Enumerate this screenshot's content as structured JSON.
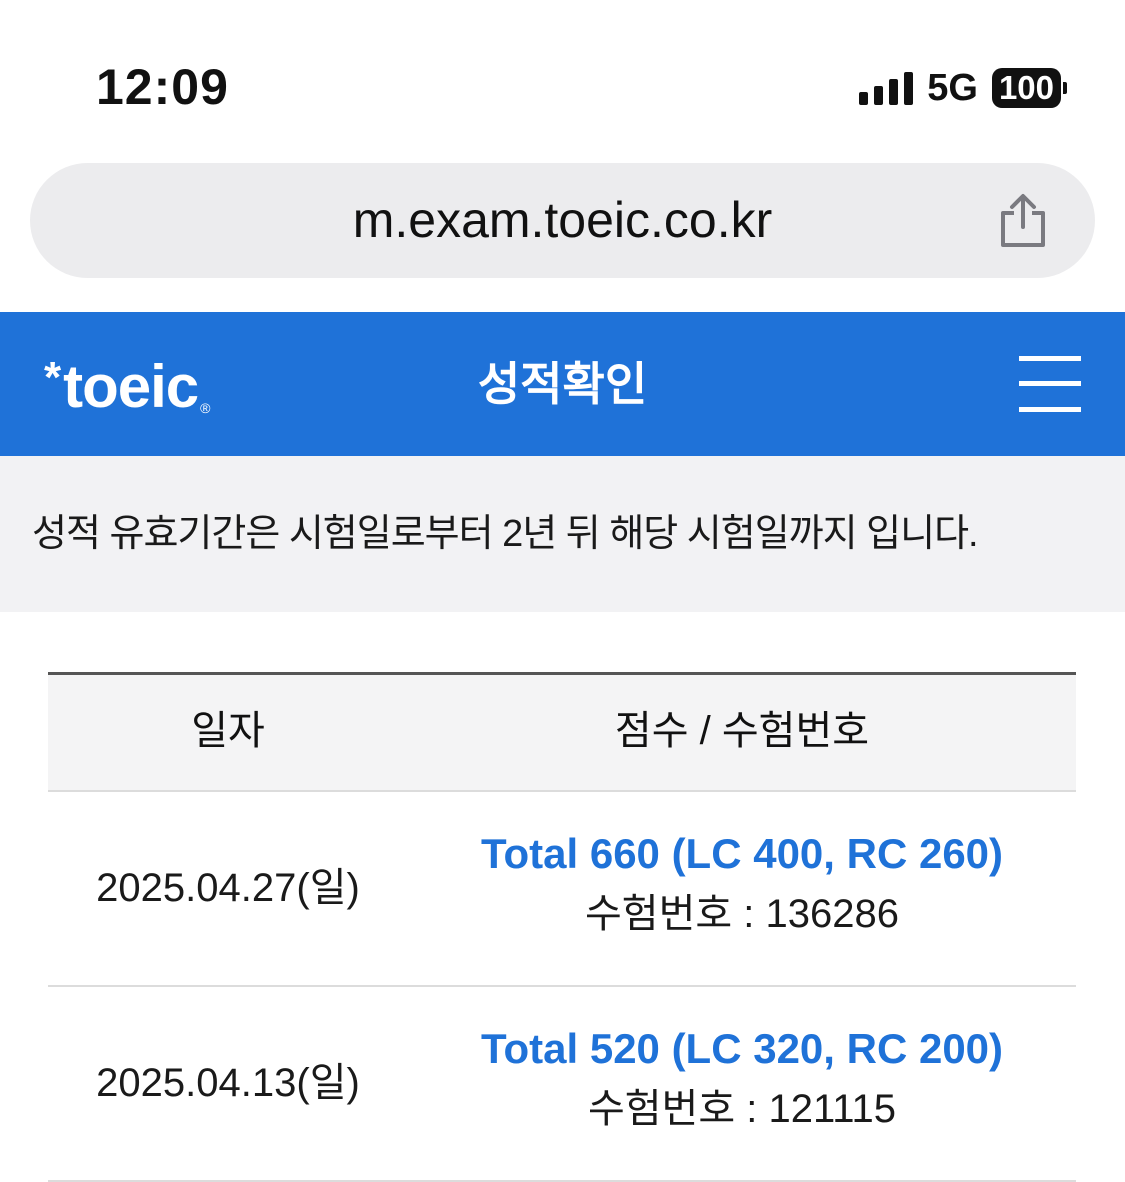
{
  "status_bar": {
    "time": "12:09",
    "network": "5G",
    "battery": "100"
  },
  "browser": {
    "url": "m.exam.toeic.co.kr",
    "share_icon": "share-icon"
  },
  "header": {
    "logo_star": "*",
    "logo_text": "toeic",
    "logo_mark": "®",
    "title": "성적확인",
    "menu_icon": "hamburger-menu-icon"
  },
  "notice": {
    "text": "성적 유효기간은 시험일로부터 2년 뒤 해당 시험일까지 입니다."
  },
  "table": {
    "headers": {
      "date": "일자",
      "score": "점수 / 수험번호"
    },
    "rows": [
      {
        "date": "2025.04.27(일)",
        "score": "Total 660 (LC 400, RC 260)",
        "exam_no": "수험번호 : 136286"
      },
      {
        "date": "2025.04.13(일)",
        "score": "Total 520 (LC 320, RC 200)",
        "exam_no": "수험번호 : 121115"
      }
    ]
  },
  "colors": {
    "brand": "#1f72d8",
    "notice_bg": "#f2f2f4",
    "url_bar_bg": "#ececee"
  }
}
